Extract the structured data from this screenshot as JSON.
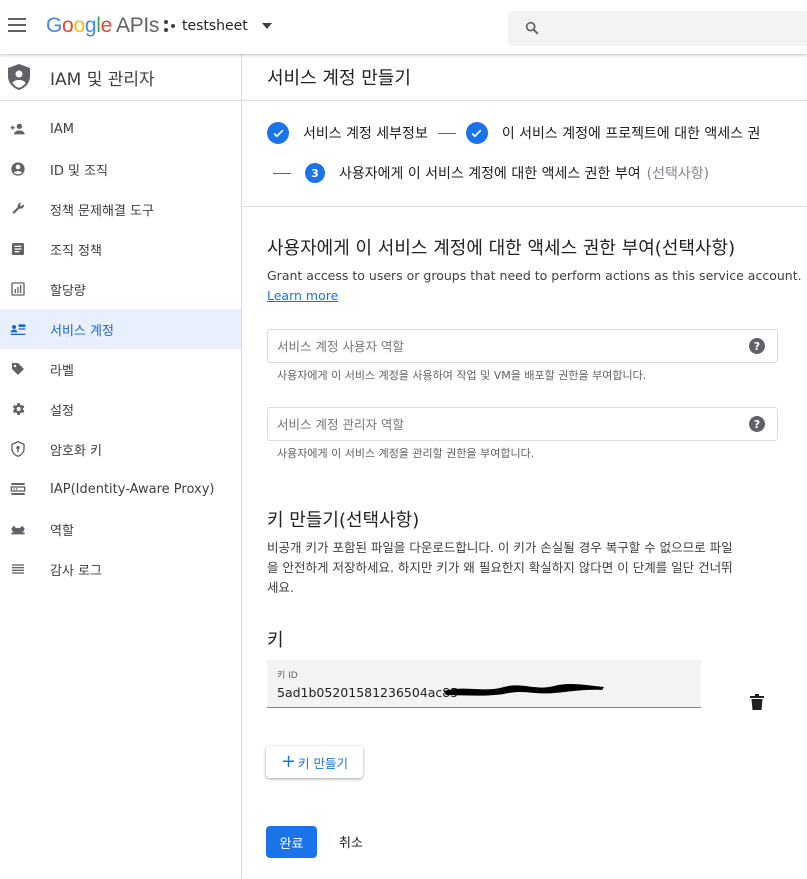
{
  "header": {
    "logo": {
      "g": "G",
      "o1": "o",
      "o2": "o",
      "g2": "g",
      "l": "l",
      "e": "e",
      "apis": "APIs"
    },
    "project_name": "testsheet",
    "search_placeholder": ""
  },
  "sidebar": {
    "title": "IAM 및 관리자",
    "items": [
      {
        "label": "IAM",
        "icon": "person-add-icon",
        "active": false
      },
      {
        "label": "ID 및 조직",
        "icon": "account-circle-icon",
        "active": false
      },
      {
        "label": "정책 문제해결 도구",
        "icon": "wrench-icon",
        "active": false
      },
      {
        "label": "조직 정책",
        "icon": "document-icon",
        "active": false
      },
      {
        "label": "할당량",
        "icon": "quota-icon",
        "active": false
      },
      {
        "label": "서비스 계정",
        "icon": "service-account-icon",
        "active": true
      },
      {
        "label": "라벨",
        "icon": "label-icon",
        "active": false
      },
      {
        "label": "설정",
        "icon": "gear-icon",
        "active": false
      },
      {
        "label": "암호화 키",
        "icon": "shield-key-icon",
        "active": false
      },
      {
        "label": "IAP(Identity-Aware Proxy)",
        "icon": "iap-icon",
        "active": false
      },
      {
        "label": "역할",
        "icon": "roles-icon",
        "active": false
      },
      {
        "label": "감사 로그",
        "icon": "list-icon",
        "active": false
      }
    ]
  },
  "main": {
    "page_title": "서비스 계정 만들기",
    "steps": {
      "step1": "서비스 계정 세부정보",
      "step2": "이 서비스 계정에 프로젝트에 대한 액세스 권",
      "step3_number": "3",
      "step3": "사용자에게 이 서비스 계정에 대한 액세스 권한 부여",
      "step3_optional": "(선택사항)"
    },
    "grant_section": {
      "title": "사용자에게 이 서비스 계정에 대한 액세스 권한 부여(선택사항)",
      "description": "Grant access to users or groups that need to perform actions as this service account.",
      "learn_more": "Learn more",
      "user_role_placeholder": "서비스 계정 사용자 역할",
      "user_role_hint": "사용자에게 이 서비스 계정을 사용하여 작업 및 VM을 배포할 권한을 부여합니다.",
      "admin_role_placeholder": "서비스 계정 관리자 역할",
      "admin_role_hint": "사용자에게 이 서비스 계정을 관리할 권한을 부여합니다."
    },
    "key_section": {
      "title": "키 만들기(선택사항)",
      "description_line1": "비공개 키가 포함된 파일을 다운로드합니다. 이 키가 손실될 경우 복구할 수 없으므로 파일",
      "description_line2": "을 안전하게 저장하세요. 하지만 키가 왜 필요한지 확실하지 않다면 이 단계를 일단 건너뛰",
      "description_line3": "세요.",
      "key_heading": "키",
      "key_id_label": "키 ID",
      "key_id_value": "5ad1b05201581236504ac85",
      "create_key_button": "키 만들기"
    },
    "done_button": "완료",
    "cancel_button": "취소"
  },
  "colors": {
    "accent": "#1a73e8",
    "active_bg": "#e8f0fe",
    "active_text": "#1967d2"
  }
}
